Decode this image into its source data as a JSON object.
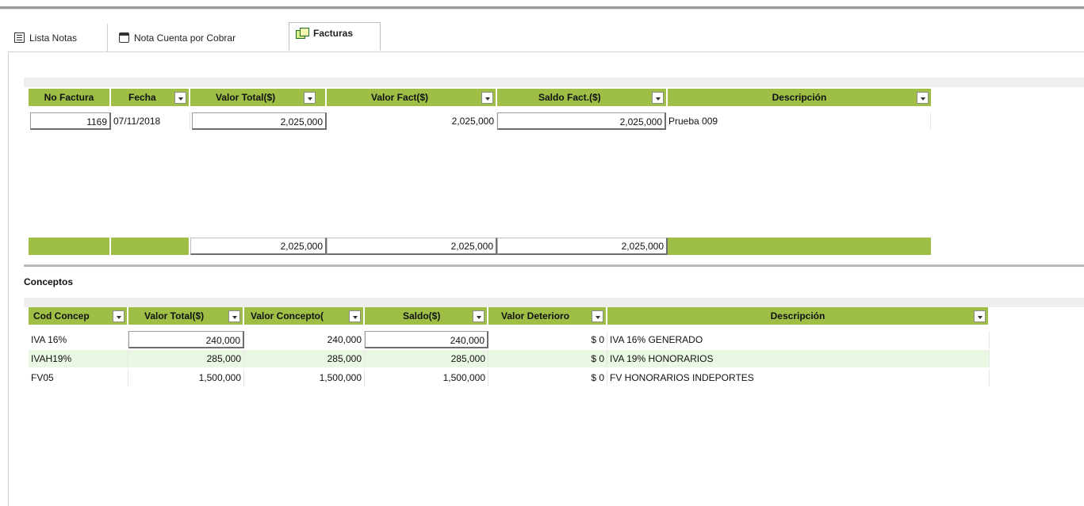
{
  "tabs": [
    {
      "label": "Lista Notas",
      "icon": "list-icon"
    },
    {
      "label": "Nota Cuenta por Cobrar",
      "icon": "note-icon"
    },
    {
      "label": "Facturas",
      "icon": "invoices-icon",
      "active": true
    }
  ],
  "facturas": {
    "headers": [
      "No Factura",
      "Fecha",
      "Valor Total($)",
      "Valor Fact($)",
      "Saldo Fact.($)",
      "Descripción"
    ],
    "rows": [
      {
        "no_factura": "1169",
        "fecha": "07/11/2018",
        "valor_total": "2,025,000",
        "valor_fact": "2,025,000",
        "saldo_fact": "2,025,000",
        "descripcion": "Prueba 009"
      }
    ],
    "totals": {
      "valor_total": "2,025,000",
      "valor_fact": "2,025,000",
      "saldo_fact": "2,025,000"
    }
  },
  "conceptos": {
    "title": "Conceptos",
    "headers": [
      "Cod Concep",
      "Valor Total($)",
      "Valor Concepto(",
      "Saldo($)",
      "Valor Deterioro",
      "Descripción"
    ],
    "rows": [
      {
        "cod": "IVA 16%",
        "valor_total": "240,000",
        "valor_concepto": "240,000",
        "saldo": "240,000",
        "deterioro": "$ 0",
        "descripcion": "IVA 16% GENERADO"
      },
      {
        "cod": "IVAH19%",
        "valor_total": "285,000",
        "valor_concepto": "285,000",
        "saldo": "285,000",
        "deterioro": "$ 0",
        "descripcion": "IVA 19% HONORARIOS"
      },
      {
        "cod": "FV05",
        "valor_total": "1,500,000",
        "valor_concepto": "1,500,000",
        "saldo": "1,500,000",
        "deterioro": "$ 0",
        "descripcion": "FV HONORARIOS INDEPORTES"
      }
    ]
  },
  "colors": {
    "header_green": "#9ebe46",
    "alt_row": "#eaf8e3"
  }
}
